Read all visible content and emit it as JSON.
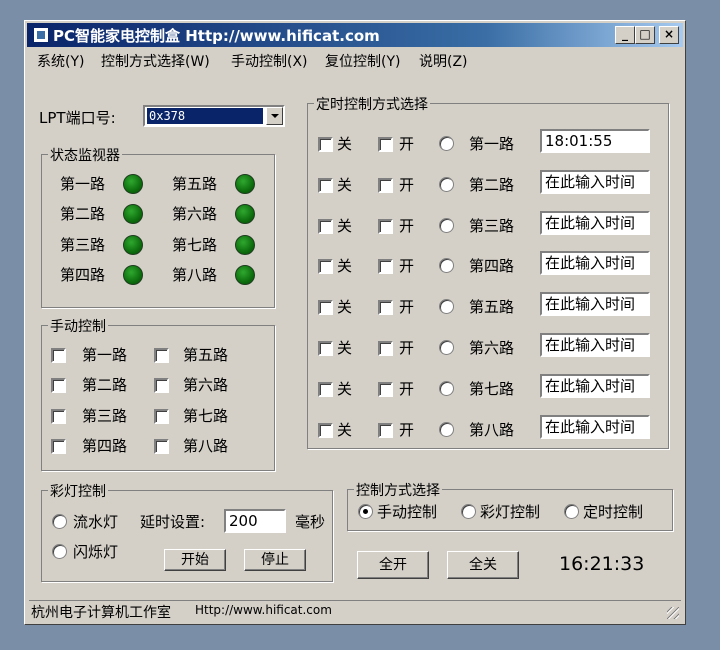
{
  "window": {
    "title": "PC智能家电控制盒 Http://www.hificat.com"
  },
  "titlebar_buttons": {
    "minimize": "_",
    "maximize": "□",
    "close": "×"
  },
  "menu": [
    "系统(Y)",
    "控制方式选择(W)",
    "手动控制(X)",
    "复位控制(Y)",
    "说明(Z)"
  ],
  "lpt": {
    "label": "LPT端口号:",
    "value": "0x378"
  },
  "status_monitor": {
    "title": "状态监视器",
    "items": [
      "第一路",
      "第五路",
      "第二路",
      "第六路",
      "第三路",
      "第七路",
      "第四路",
      "第八路"
    ],
    "led_color": "#1b8a1b"
  },
  "manual_control": {
    "title": "手动控制",
    "items": [
      "第一路",
      "第五路",
      "第二路",
      "第六路",
      "第三路",
      "第七路",
      "第四路",
      "第八路"
    ]
  },
  "light_control": {
    "title": "彩灯控制",
    "option_flow": "流水灯",
    "option_flash": "闪烁灯",
    "delay_label": "延时设置:",
    "delay_value": "200",
    "delay_unit": "毫秒",
    "start_button": "开始",
    "stop_button": "停止"
  },
  "timer_control": {
    "title": "定时控制方式选择",
    "off_label": "关",
    "on_label": "开",
    "routes": [
      "第一路",
      "第二路",
      "第三路",
      "第四路",
      "第五路",
      "第六路",
      "第七路",
      "第八路"
    ],
    "times": [
      "18:01:55",
      "在此输入时间",
      "在此输入时间",
      "在此输入时间",
      "在此输入时间",
      "在此输入时间",
      "在此输入时间",
      "在此输入时间"
    ]
  },
  "mode_select": {
    "title": "控制方式选择",
    "options": [
      "手动控制",
      "彩灯控制",
      "定时控制"
    ],
    "selected": "手动控制"
  },
  "all_on_button": "全开",
  "all_off_button": "全关",
  "clock": "16:21:33",
  "statusbar": {
    "studio": "杭州电子计算机工作室",
    "url": "Http://www.hificat.com"
  }
}
